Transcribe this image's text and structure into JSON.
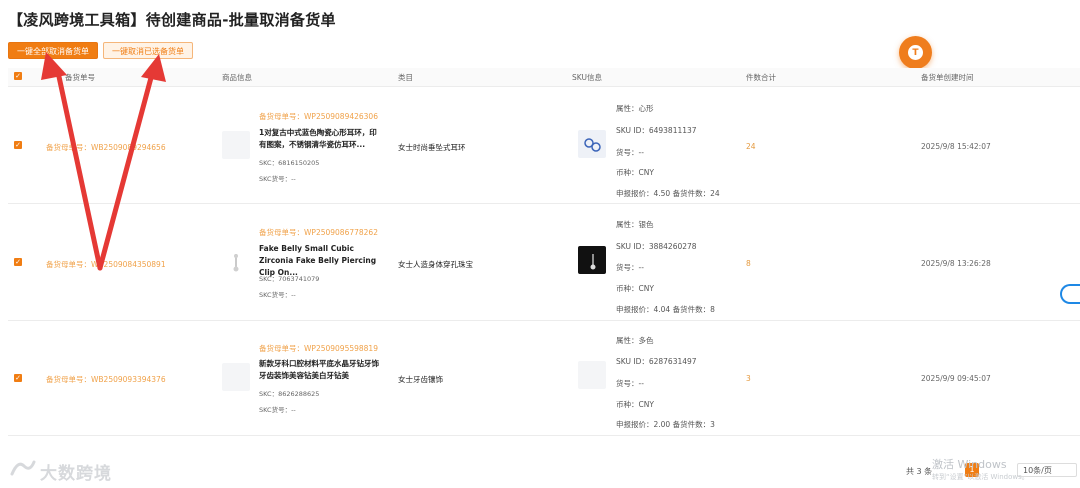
{
  "page": {
    "title": "【凌风跨境工具箱】待创建商品-批量取消备货单"
  },
  "toolbar": {
    "cancel_all_label": "一键全部取消备货单",
    "cancel_selected_label": "一键取消已选备货单"
  },
  "avatar": {
    "letter": "T"
  },
  "table": {
    "headers": [
      "备货单号",
      "商品信息",
      "类目",
      "SKU信息",
      "件数合计",
      "备货单创建时间"
    ],
    "rows": [
      {
        "order_no": "备货母单号：WB2509089294656",
        "product": {
          "parent_no": "备货母单号：WP2509089426306",
          "name": "1对复古中式蓝色陶瓷心形耳环，印有图案，不锈钢清华瓷仿耳环...",
          "skc": "SKC：6816150205",
          "skc_goods_no": "SKC货号：--"
        },
        "category": "女士时尚垂坠式耳环",
        "sku": {
          "attr": "属性：心形",
          "sku_id": "SKU ID：6493811137",
          "goods_no": "货号：--",
          "currency": "币种：CNY",
          "declare": "申报报价：4.50 备货件数：24"
        },
        "qty": "24",
        "created": "2025/9/8 15:42:07"
      },
      {
        "order_no": "备货母单号：WB2509084350891",
        "product": {
          "parent_no": "备货母单号：WP2509086778262",
          "name": "Fake Belly Small Cubic Zirconia Fake Belly Piercing Clip On...",
          "skc": "SKC：7063741079",
          "skc_goods_no": "SKC货号：--"
        },
        "category": "女士人造身体穿孔珠宝",
        "sku": {
          "attr": "属性：银色",
          "sku_id": "SKU ID：3884260278",
          "goods_no": "货号：--",
          "currency": "币种：CNY",
          "declare": "申报报价：4.04 备货件数：8"
        },
        "qty": "8",
        "created": "2025/9/8 13:26:28"
      },
      {
        "order_no": "备货母单号：WB2509093394376",
        "product": {
          "parent_no": "备货母单号：WP2509095598819",
          "name": "新款牙科口腔材料平底水晶牙钻牙饰牙齿装饰美容钻美白牙钻美",
          "skc": "SKC：8626288625",
          "skc_goods_no": "SKC货号：--"
        },
        "category": "女士牙齿镶饰",
        "sku": {
          "attr": "属性：多色",
          "sku_id": "SKU ID：6287631497",
          "goods_no": "货号：--",
          "currency": "币种：CNY",
          "declare": "申报报价：2.00 备货件数：3"
        },
        "qty": "3",
        "created": "2025/9/9 09:45:07"
      }
    ]
  },
  "pagination": {
    "total": "共 3 条",
    "current_page": "1",
    "page_size": "10条/页"
  },
  "watermark": {
    "windows_main": "激活 Windows",
    "windows_sub": "转到“设置”以激活 Windows。",
    "brand": "大数跨境"
  },
  "colors": {
    "accent": "#f07d13",
    "arrow_red": "#e53935",
    "link_orange": "#f0a24a"
  }
}
